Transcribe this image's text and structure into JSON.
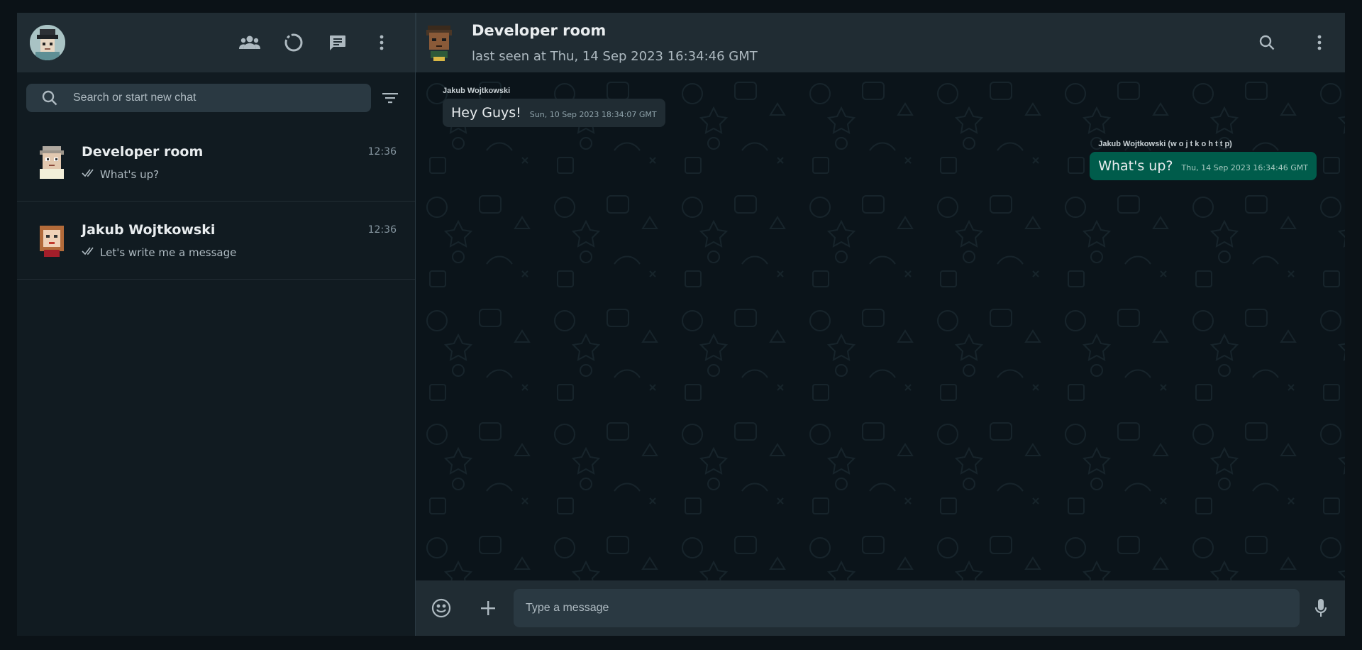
{
  "colors": {
    "page_bg": "#0b1217",
    "panel_header": "#202c33",
    "sidebar_bg": "#111b21",
    "incoming_bubble": "#202c33",
    "outgoing_bubble": "#005c4b",
    "icon": "#aebac1"
  },
  "sidebar": {
    "header_icons": [
      "community-icon",
      "status-icon",
      "new-chat-icon",
      "menu-icon"
    ],
    "search": {
      "placeholder": "Search or start new chat"
    },
    "chats": [
      {
        "name": "Developer room",
        "time": "12:36",
        "preview": "What's up?",
        "status_icon": "double-check-icon"
      },
      {
        "name": "Jakub Wojtkowski",
        "time": "12:36",
        "preview": "Let's write me a message",
        "status_icon": "double-check-icon"
      }
    ]
  },
  "conversation": {
    "title": "Developer room",
    "subtitle": "last seen at Thu, 14 Sep 2023 16:34:46 GMT",
    "header_icons": [
      "search-icon",
      "menu-icon"
    ],
    "messages": [
      {
        "direction": "in",
        "sender": "Jakub Wojtkowski",
        "text": "Hey Guys!",
        "timestamp": "Sun, 10 Sep 2023 18:34:07 GMT"
      },
      {
        "direction": "out",
        "sender": "Jakub Wojtkowski (w o j t k o h t t p)",
        "text": "What's up?",
        "timestamp": "Thu, 14 Sep 2023 16:34:46 GMT"
      }
    ]
  },
  "composer": {
    "placeholder": "Type a message",
    "icons": [
      "emoji-icon",
      "attach-plus-icon",
      "microphone-icon"
    ]
  }
}
